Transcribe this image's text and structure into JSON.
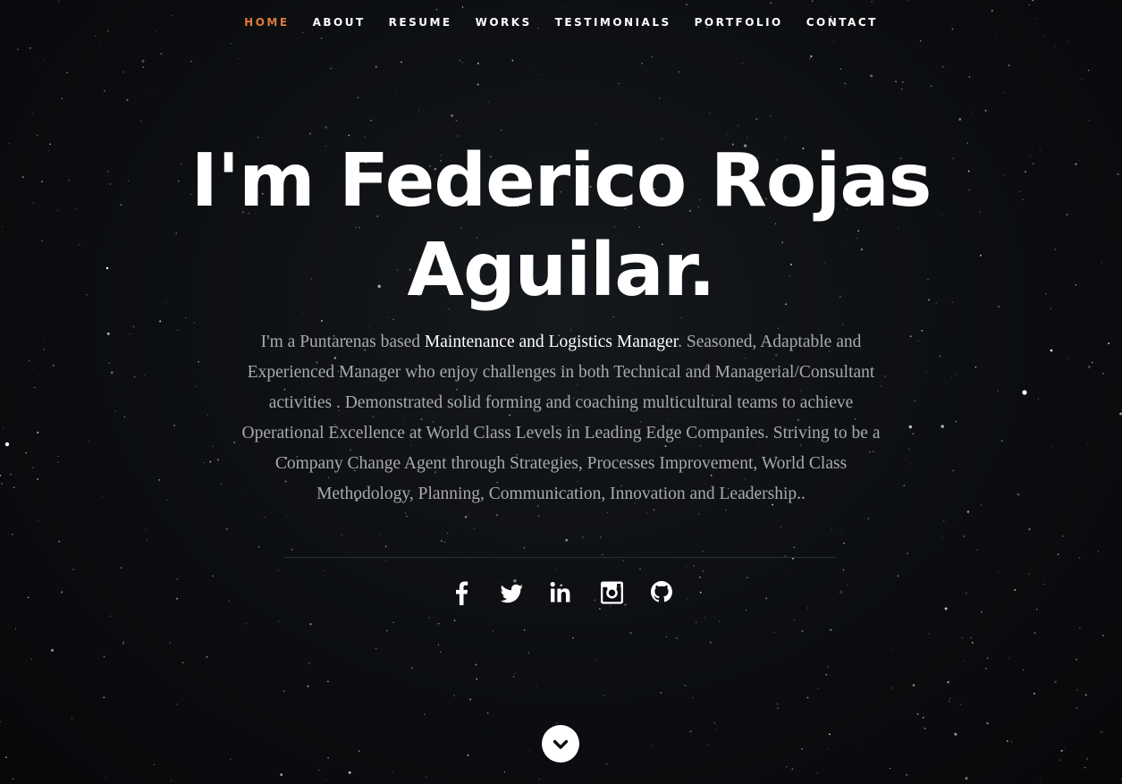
{
  "nav": {
    "items": [
      {
        "label": "HOME",
        "active": true
      },
      {
        "label": "ABOUT",
        "active": false
      },
      {
        "label": "RESUME",
        "active": false
      },
      {
        "label": "WORKS",
        "active": false
      },
      {
        "label": "TESTIMONIALS",
        "active": false
      },
      {
        "label": "PORTFOLIO",
        "active": false
      },
      {
        "label": "CONTACT",
        "active": false
      }
    ],
    "active_color": "#e07b39"
  },
  "hero": {
    "title_line1": "I'm Federico Rojas",
    "title_line2": "Aguilar.",
    "intro_prefix": "I'm a Puntarenas based ",
    "intro_highlight": "Maintenance and Logistics Manager",
    "intro_suffix": ". Seasoned, Adaptable and Experienced Manager who enjoy challenges in both Technical and Managerial/Consultant activities . Demonstrated solid forming and coaching multicultural teams to achieve Operational Excellence at World Class Levels in Leading Edge Companies. Striving to be a Company Change Agent through Strategies, Processes Improvement, World Class Methodology, Planning, Communication, Innovation and Leadership.."
  },
  "social": {
    "icons": [
      "facebook-icon",
      "twitter-icon",
      "linkedin-icon",
      "instagram-icon",
      "github-icon"
    ]
  },
  "scroll": {
    "icon": "chevron-down-icon"
  },
  "colors": {
    "background": "#0b0d10",
    "text_muted": "#a9aaac",
    "text_white": "#ffffff"
  }
}
